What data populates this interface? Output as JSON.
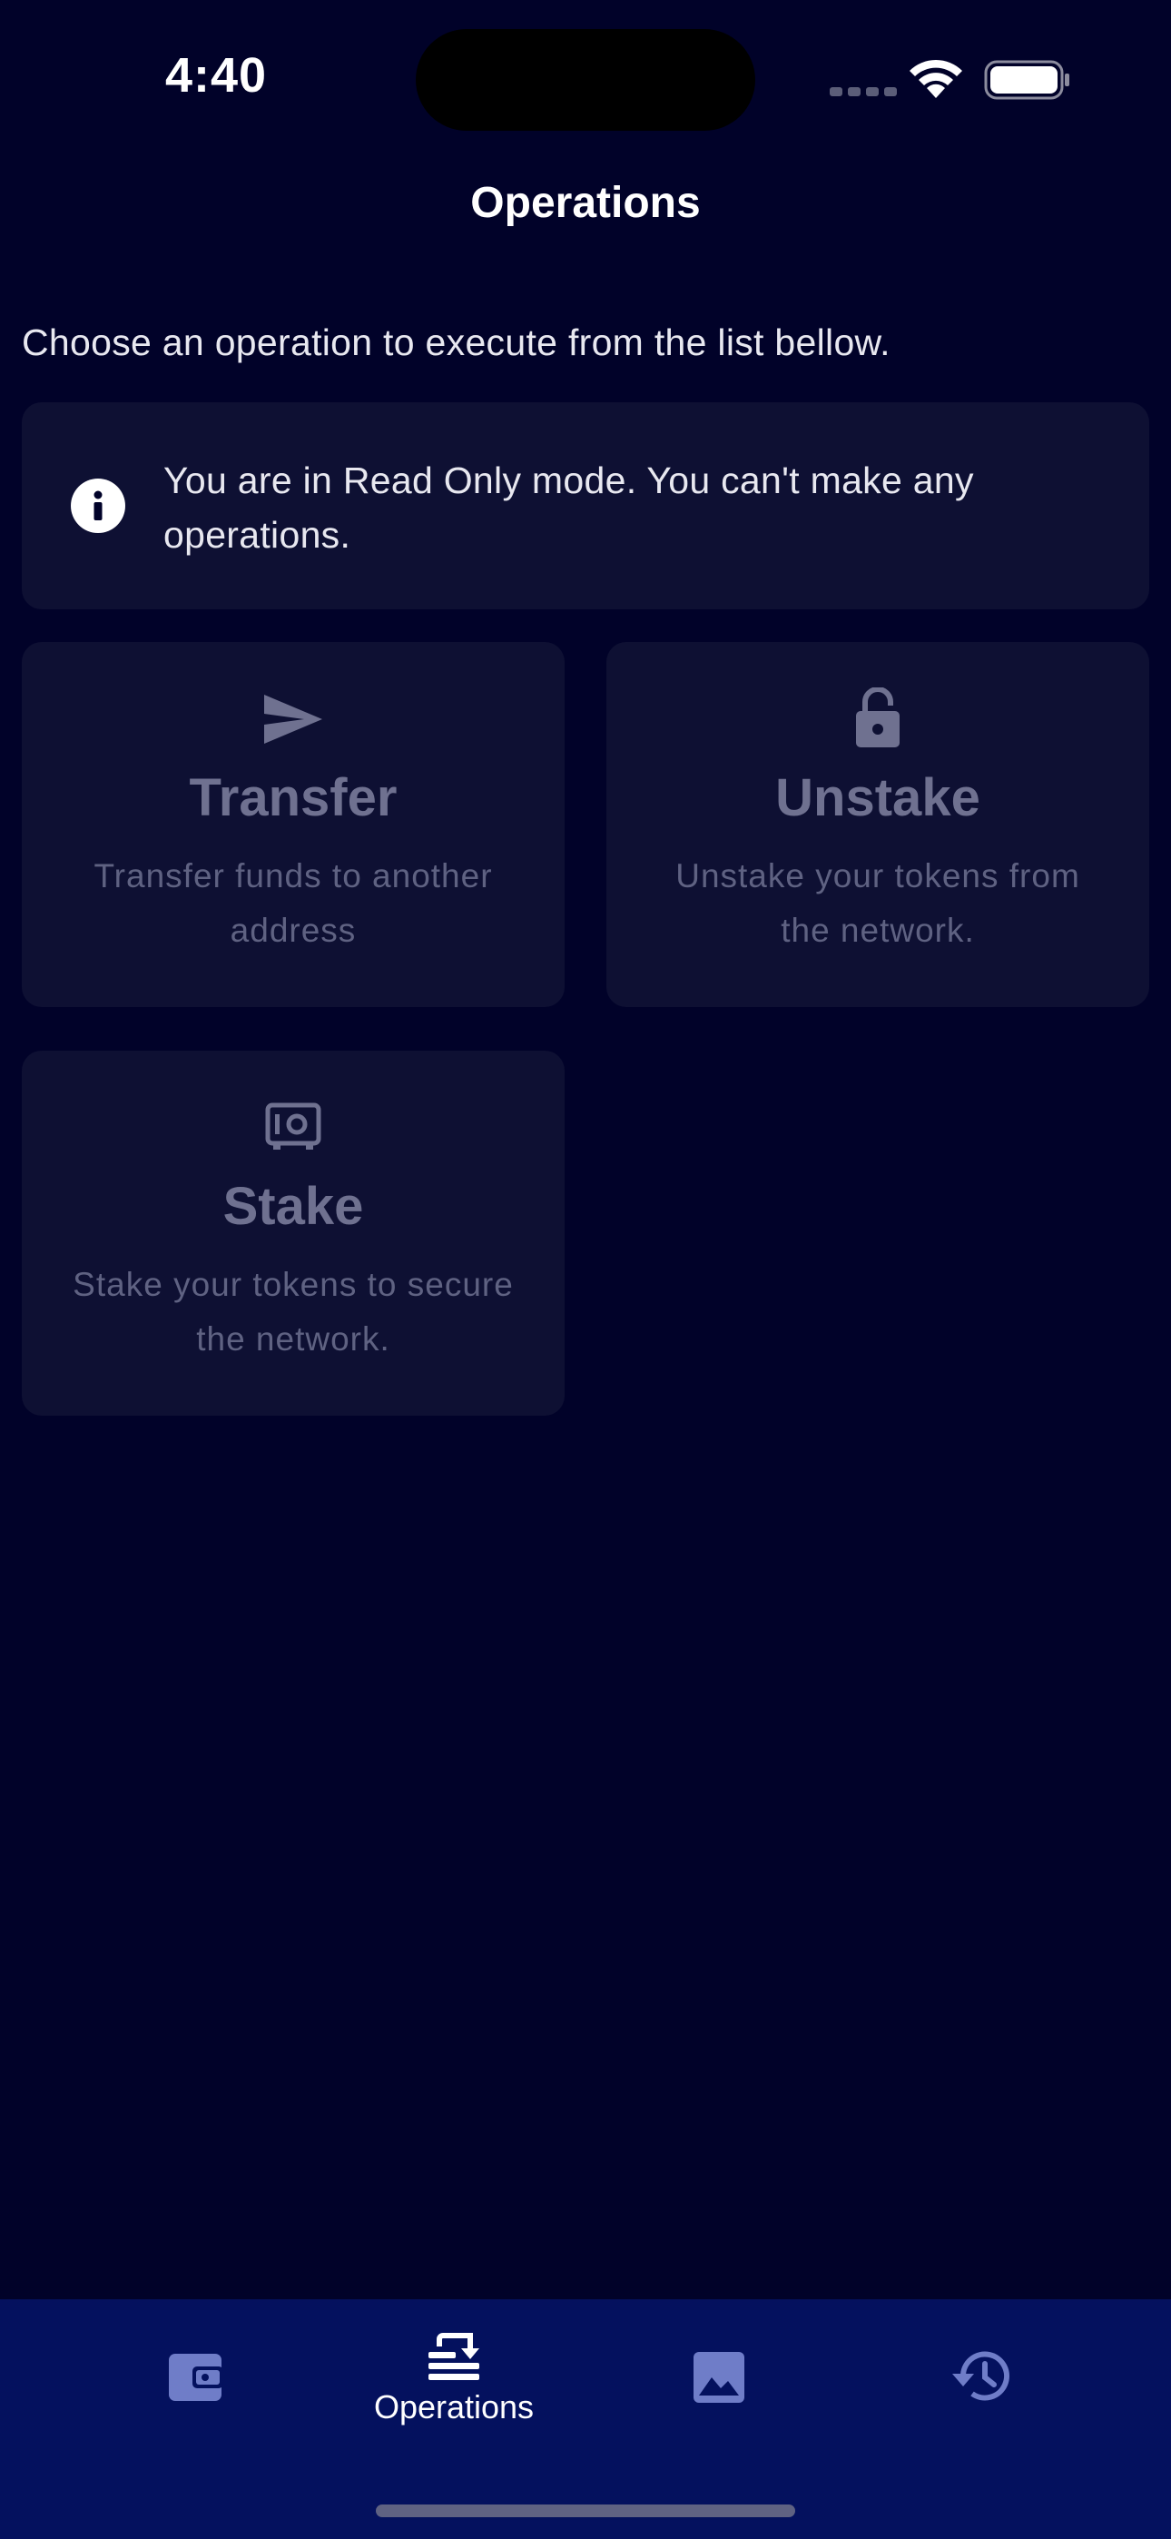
{
  "status_bar": {
    "time": "4:40"
  },
  "header": {
    "title": "Operations"
  },
  "intro": "Choose an operation to execute from the list bellow.",
  "info_banner": {
    "icon": "info-icon",
    "text": "You are in Read Only mode. You can't make any operations."
  },
  "operations": [
    {
      "icon": "send-icon",
      "title": "Transfer",
      "description": "Transfer funds to another address"
    },
    {
      "icon": "lock-open-icon",
      "title": "Unstake",
      "description": "Unstake your tokens from the network."
    },
    {
      "icon": "safe-icon",
      "title": "Stake",
      "description": "Stake your tokens to secure the network."
    }
  ],
  "bottom_nav": {
    "items": [
      {
        "icon": "wallet-icon",
        "label": ""
      },
      {
        "icon": "operations-icon",
        "label": "Operations",
        "active": true
      },
      {
        "icon": "image-icon",
        "label": ""
      },
      {
        "icon": "history-icon",
        "label": ""
      }
    ]
  },
  "colors": {
    "background": "#010229",
    "card": "#0e1033",
    "nav_background": "#04115e",
    "nav_icon_inactive": "#6f7dc8",
    "disabled_text": "#6f7190"
  }
}
